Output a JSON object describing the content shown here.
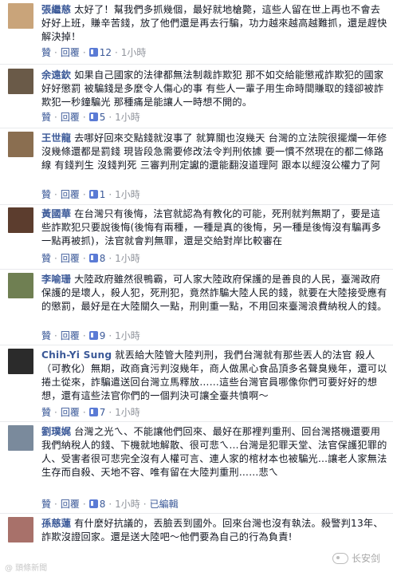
{
  "comments": [
    {
      "name": "張繼慈",
      "text": "太好了！幫我們多抓幾個，最好就地槍斃，這些人留在世上再也不會去好好上班，賺辛苦錢，放了他們還是再去行騙，功力越來越高越難抓，還是趕快解決掉！",
      "like": "贊",
      "reply": "回覆",
      "likes": "12",
      "time": "1小時",
      "avatar_color": "#c9a47a"
    },
    {
      "name": "余遠欽",
      "text": "如果自己國家的法律都無法制裁詐欺犯 那不如交給能懲戒詐欺犯的國家 好好懲罰 被騙錢是多麼令人傷心的事 有些人一輩子用生命時間賺取的錢卻被詐欺犯一秒鐘騙光 那種痛是能讓人一時想不開的。",
      "like": "贊",
      "reply": "回覆",
      "likes": "5",
      "time": "1小時",
      "avatar_color": "#6a5a48"
    },
    {
      "name": "王世龍",
      "text": "去哪好回來交點錢就沒事了 就算關也沒幾天 台灣的立法院很擺爛一年修沒幾條還都是罰錢 現皆段急需要修改法令判刑依據 要一慣不然現在的都二條路線 有錢判生 沒錢判死 三審判刑定讞的還能翻沒道理阿 跟本以經沒公權力了阿",
      "like": "贊",
      "reply": "回覆",
      "likes": "1",
      "time": "1小時",
      "avatar_color": "#8a6e50"
    },
    {
      "name": "黃國華",
      "text": "在台灣只有後悔，法官就認為有教化的可能，死刑就判無期了，要是這些詐欺犯只要說後悔(後悔有兩種，一種是真的後悔，另一種是後悔沒有騙再多一點再被抓)，法官就會判無罪，還是交給對岸比較審在",
      "like": "贊",
      "reply": "回覆",
      "likes": "8",
      "time": "1小時",
      "avatar_color": "#5c3d2e"
    },
    {
      "name": "李喻珊",
      "text": "大陸政府雖然很鴨霸，可人家大陸政府保護的是善良的人民，臺灣政府保護的是壞人，殺人犯，死刑犯，竟然詐騙大陸人民的錢，就要在大陸接受應有的懲罰，最好是在大陸關久一點，刑則重一點，不用回來臺灣浪費納稅人的錢。",
      "like": "贊",
      "reply": "回覆",
      "likes": "9",
      "time": "1小時",
      "avatar_color": "#6f7f52"
    },
    {
      "name": "Chih-Yi Sung",
      "text": "就丟給大陸管大陸判刑，我們台灣就有那些丟人的法官 殺人（可教化）無期，政商貪污判沒幾年，商人做黑心食品頂多名聲臭幾年，還可以捲土從來，詐騙遣送回台灣立馬釋放……這些台灣官員哪像你們可要好好的想想，還有這些法官你們的一個判決可讓全臺共憤啊～",
      "like": "贊",
      "reply": "回覆",
      "likes": "7",
      "time": "1小時",
      "avatar_color": "#2b2b2b"
    },
    {
      "name": "劉璞娓",
      "text": "台灣之光ㄟ、不能讓他們回來、最好在那裡判重刑、回台灣搭機還要用我們納稅人的錢、下機就地解散、很可悲ㄟ…台灣是犯罪天堂、法官保護犯罪的人、受害者很可悲完全沒有人權可言、連人家的棺材本也被騙光…讓老人家無法生存而自殺、天地不容、唯有留在大陸判重刑……悲ㄟ",
      "like": "贊",
      "reply": "回覆",
      "likes": "8",
      "time": "1小時",
      "edited": "已編輯",
      "avatar_color": "#7a8a9c"
    },
    {
      "name": "孫慈蓮",
      "text": "有什麼好抗議的，丟臉丟到國外。回來台灣也沒有執法。殺警判13年、詐欺沒證回家。還是送大陸吧～他們要為自己的行為負責!",
      "avatar_color": "#a8716a"
    }
  ],
  "watermark": "长安剑",
  "corner_mark": "@ 頭條新聞"
}
